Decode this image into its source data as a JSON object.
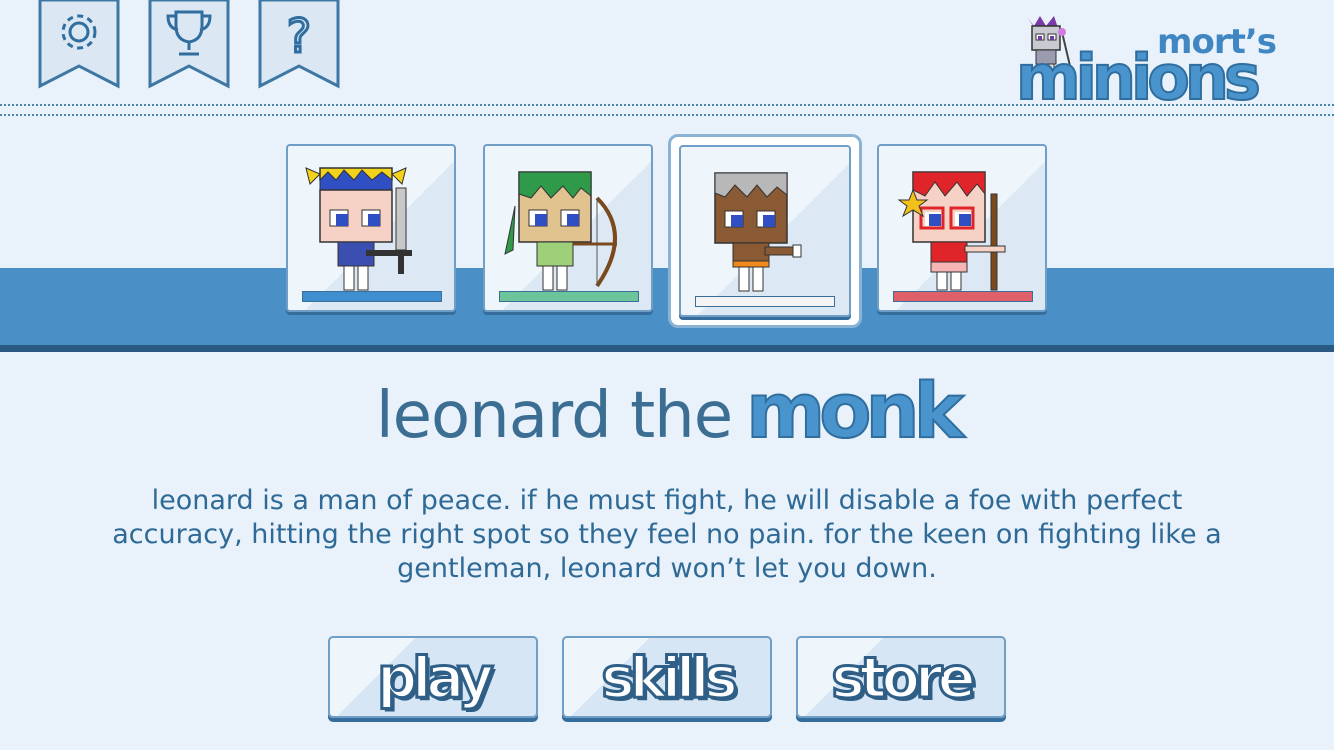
{
  "topbar": {
    "icons": [
      {
        "name": "settings",
        "icon": "gear-icon"
      },
      {
        "name": "achievements",
        "icon": "trophy-icon"
      },
      {
        "name": "help",
        "icon": "question-icon",
        "glyph": "?"
      }
    ]
  },
  "logo": {
    "small": "mort’s",
    "big": "minions"
  },
  "characters": [
    {
      "id": "warrior",
      "bar_color": "#3f8fd0",
      "selected": false
    },
    {
      "id": "ranger",
      "bar_color": "#6cc59a",
      "selected": false
    },
    {
      "id": "monk",
      "bar_color": "#f4f4f4",
      "selected": true
    },
    {
      "id": "archer",
      "bar_color": "#e0606a",
      "selected": false
    }
  ],
  "hero": {
    "name_prefix": "leonard the",
    "name_class": "monk",
    "description": "leonard is a man of peace. if he must fight, he will disable a foe with perfect accuracy, hitting the right spot so they feel no pain. for the keen on fighting like a gentleman, leonard won’t let you down."
  },
  "buttons": {
    "play": "play",
    "skills": "skills",
    "store": "store"
  },
  "colors": {
    "background": "#e9f2fb",
    "band": "#4a8fc6",
    "accent": "#4a94cd",
    "dark": "#2f6e9e"
  }
}
